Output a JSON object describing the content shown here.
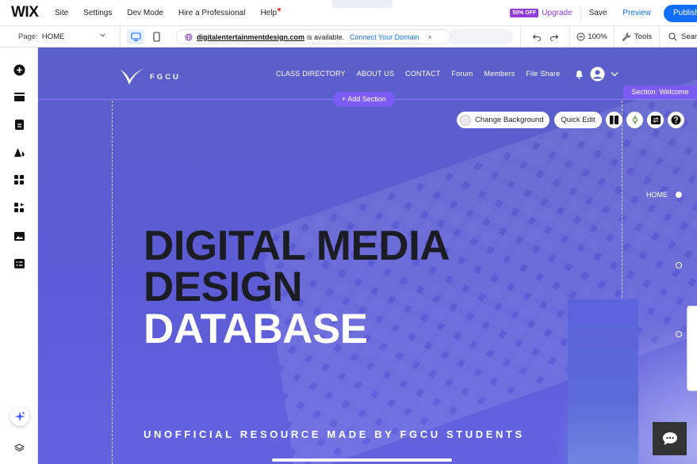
{
  "topbar": {
    "logo": "WIX",
    "menu": [
      "Site",
      "Settings",
      "Dev Mode",
      "Hire a Professional",
      "Help"
    ],
    "promo_badge": "50% OFF",
    "upgrade": "Upgrade",
    "save": "Save",
    "preview": "Preview",
    "publish": "Publish"
  },
  "bar2": {
    "page_label": "Page:",
    "page_value": "HOME",
    "domain": "digitalentertainmentdesign.com",
    "domain_status": "is available.",
    "connect": "Connect Your Domain",
    "close": "×",
    "zoom": "100%",
    "tools": "Tools",
    "search": "Search"
  },
  "left_panel": {
    "icons": [
      "add-elements-icon",
      "sections-icon",
      "pages-icon",
      "site-design-icon",
      "add-apps-icon",
      "my-business-icon",
      "media-icon",
      "cms-icon",
      "ai-assistant-icon",
      "layers-icon"
    ]
  },
  "site": {
    "logo": "FGCU",
    "nav": [
      "CLASS DIRECTORY",
      "ABOUT US",
      "CONTACT",
      "Forum",
      "Members",
      "File Share"
    ],
    "add_section": "+ Add Section",
    "section_tag": "Section: Welcome",
    "change_background": "Change Background",
    "quick_edit": "Quick Edit",
    "anchor_label": "HOME",
    "hero": [
      "DIGITAL MEDIA",
      "DESIGN",
      "DATABASE"
    ],
    "subtitle": "UNOFFICIAL RESOURCE MADE BY FGCU STUDENTS"
  },
  "colors": {
    "accent": "#116dff",
    "upgrade_purple": "#8e3bd9",
    "section_purple": "#7b5cf5",
    "hero_dark": "#1c1c24"
  }
}
